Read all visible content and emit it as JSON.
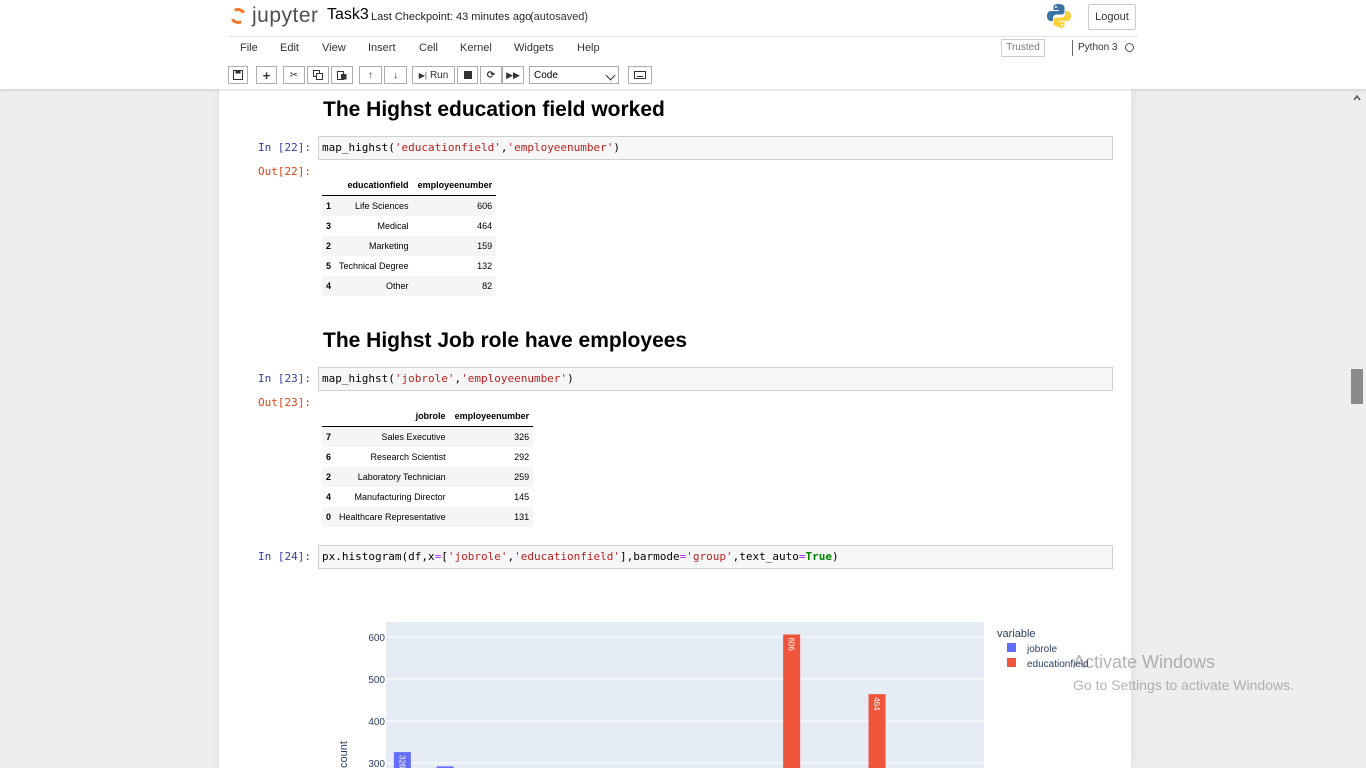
{
  "header": {
    "logo_text": "jupyter",
    "notebook_name": "Task3",
    "checkpoint": "Last Checkpoint: 43 minutes ago",
    "autosave": "(autosaved)",
    "logout": "Logout",
    "trusted": "Trusted",
    "kernel": "Python 3"
  },
  "menu": [
    "File",
    "Edit",
    "View",
    "Insert",
    "Cell",
    "Kernel",
    "Widgets",
    "Help"
  ],
  "toolbar": {
    "run": "Run",
    "cell_type": "Code"
  },
  "cells": {
    "md1": "The Highst education field worked",
    "in22": "In [22]:",
    "out22": "Out[22]:",
    "md2": "The Highst Job role have employees",
    "in23": "In [23]:",
    "out23": "Out[23]:",
    "in24": "In [24]:"
  },
  "table1": {
    "columns": [
      "educationfield",
      "employeenumber"
    ],
    "rows": [
      {
        "idx": "1",
        "field": "Life Sciences",
        "count": "606"
      },
      {
        "idx": "3",
        "field": "Medical",
        "count": "464"
      },
      {
        "idx": "2",
        "field": "Marketing",
        "count": "159"
      },
      {
        "idx": "5",
        "field": "Technical Degree",
        "count": "132"
      },
      {
        "idx": "4",
        "field": "Other",
        "count": "82"
      }
    ]
  },
  "table2": {
    "columns": [
      "jobrole",
      "employeenumber"
    ],
    "rows": [
      {
        "idx": "7",
        "field": "Sales Executive",
        "count": "326"
      },
      {
        "idx": "6",
        "field": "Research Scientist",
        "count": "292"
      },
      {
        "idx": "2",
        "field": "Laboratory Technician",
        "count": "259"
      },
      {
        "idx": "4",
        "field": "Manufacturing Director",
        "count": "145"
      },
      {
        "idx": "0",
        "field": "Healthcare Representative",
        "count": "131"
      }
    ]
  },
  "chart_data": {
    "type": "bar",
    "ylabel": "count",
    "yticks": [
      300,
      400,
      500,
      600
    ],
    "ylim_visible": [
      290,
      630
    ],
    "legend_title": "variable",
    "legend_placement": "top-right",
    "series": [
      {
        "name": "jobrole",
        "color": "#636efa",
        "values": [
          {
            "slot": 0,
            "value": 326,
            "label": "326"
          },
          {
            "slot": 1,
            "value": 292,
            "label": "292"
          }
        ]
      },
      {
        "name": "educationfield",
        "color": "#ef553b",
        "values": [
          {
            "slot": 9,
            "value": 606,
            "label": "606"
          },
          {
            "slot": 11,
            "value": 464,
            "label": "464"
          }
        ]
      }
    ],
    "background": "#e5ecf6"
  },
  "watermark": {
    "line1": "Activate Windows",
    "line2": "Go to Settings to activate Windows."
  }
}
